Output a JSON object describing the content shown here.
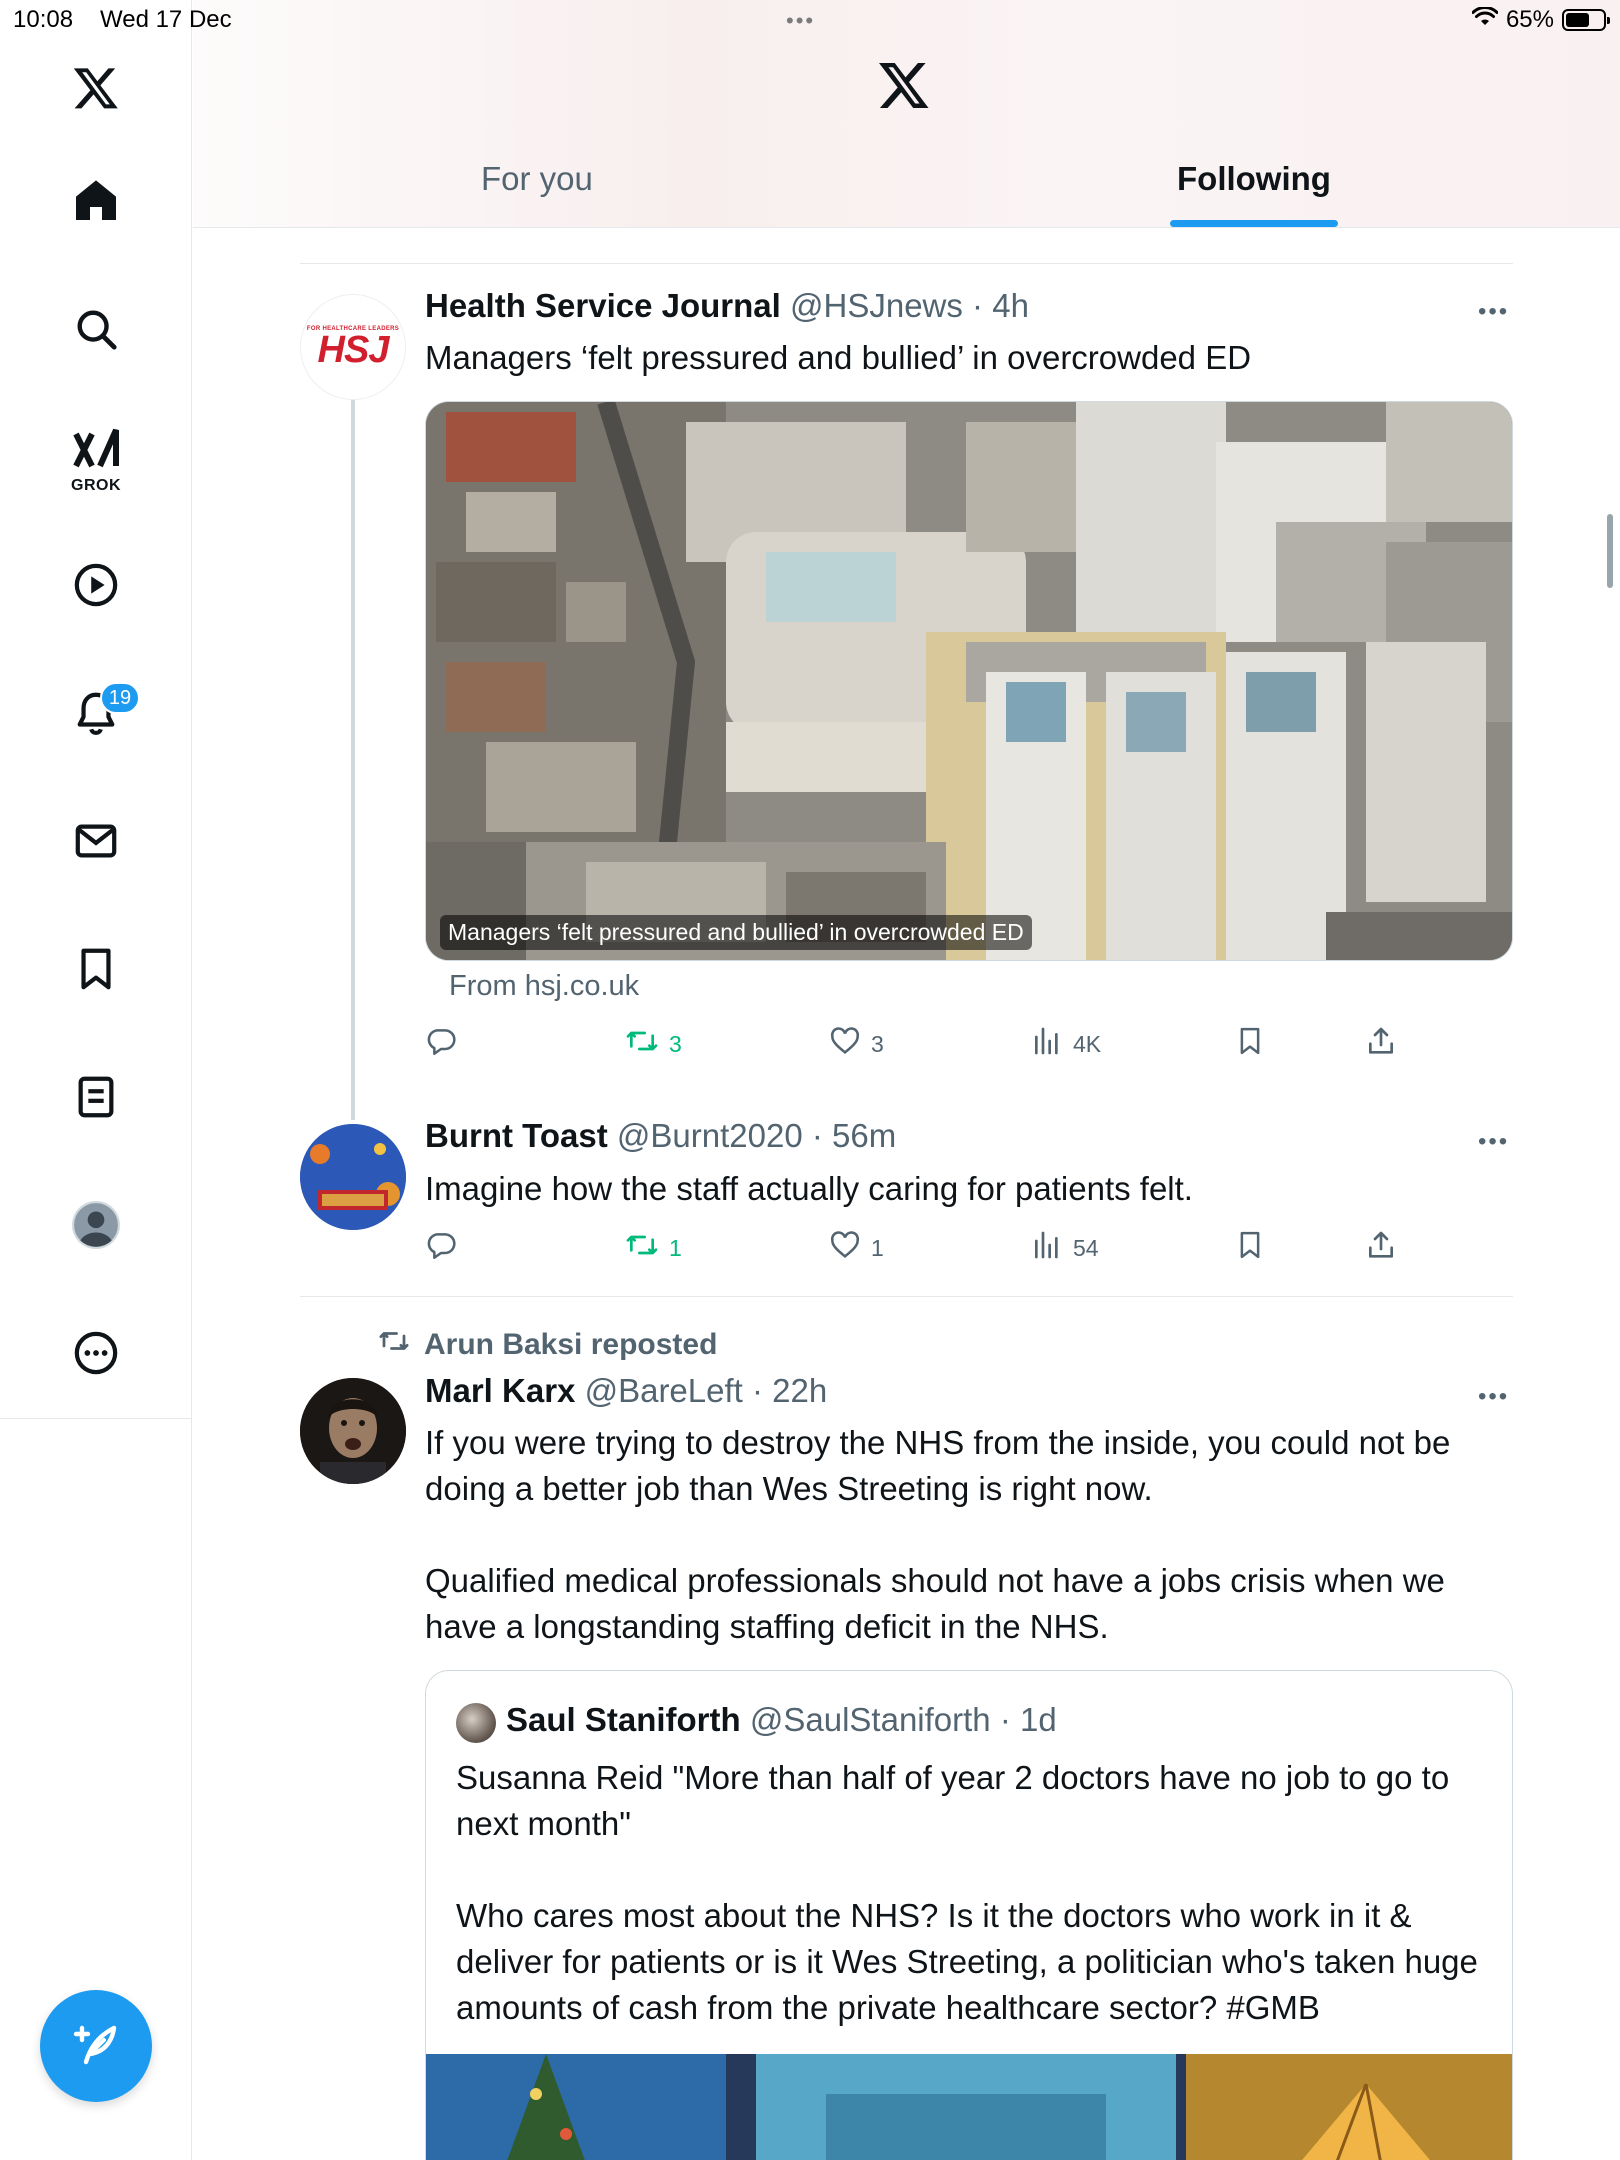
{
  "status_bar": {
    "time": "10:08",
    "date": "Wed 17 Dec",
    "dots": "•••",
    "battery_percent": "65%",
    "battery_level": 0.65
  },
  "sidebar": {
    "items": [
      {
        "name": "x-logo"
      },
      {
        "name": "home"
      },
      {
        "name": "search"
      },
      {
        "name": "grok",
        "label": "GROK"
      },
      {
        "name": "video"
      },
      {
        "name": "notifications",
        "badge": "19"
      },
      {
        "name": "messages"
      },
      {
        "name": "bookmarks"
      },
      {
        "name": "lists"
      },
      {
        "name": "profile"
      },
      {
        "name": "more"
      }
    ]
  },
  "header": {
    "tabs": [
      {
        "label": "For you",
        "active": false
      },
      {
        "label": "Following",
        "active": true
      }
    ]
  },
  "tweets": [
    {
      "name": "Health Service Journal",
      "handle": "@HSJnews",
      "time": "4h",
      "avatar_text_small": "FOR HEALTHCARE LEADERS",
      "avatar_text_big": "HSJ",
      "text": "Managers ‘felt pressured and bullied’ in overcrowded ED",
      "media_caption": "Managers ‘felt pressured and bullied’ in overcrowded ED",
      "link_source": "From hsj.co.uk",
      "counts": {
        "reply": "",
        "repost": "3",
        "like": "3",
        "views": "4K"
      }
    },
    {
      "name": "Burnt Toast",
      "handle": "@Burnt2020",
      "time": "56m",
      "text": "Imagine how the staff actually caring for patients felt.",
      "counts": {
        "reply": "",
        "repost": "1",
        "like": "1",
        "views": "54"
      }
    },
    {
      "reposted_by": "Arun Baksi reposted",
      "name": "Marl Karx",
      "handle": "@BareLeft",
      "time": "22h",
      "text_p1": "If you were trying to destroy the NHS from the inside, you could not be doing a better job than Wes Streeting is right now.",
      "text_p2": "Qualified medical professionals should not have a jobs crisis when we have a longstanding staffing deficit in the NHS.",
      "quote": {
        "name": "Saul Staniforth",
        "handle": "@SaulStaniforth",
        "time": "1d",
        "text_p1": "Susanna Reid \"More than half of year 2 doctors have no job to go to next month\"",
        "text_p2": "Who cares most about the NHS? Is it the doctors who work in it & deliver for patients or is it Wes Streeting, a politician who's taken huge amounts of cash from the private healthcare sector? #GMB"
      }
    }
  ],
  "colors": {
    "accent": "#1d9bf0",
    "repost_green": "#00ba7c",
    "text_primary": "#0f1419",
    "text_secondary": "#536471"
  }
}
